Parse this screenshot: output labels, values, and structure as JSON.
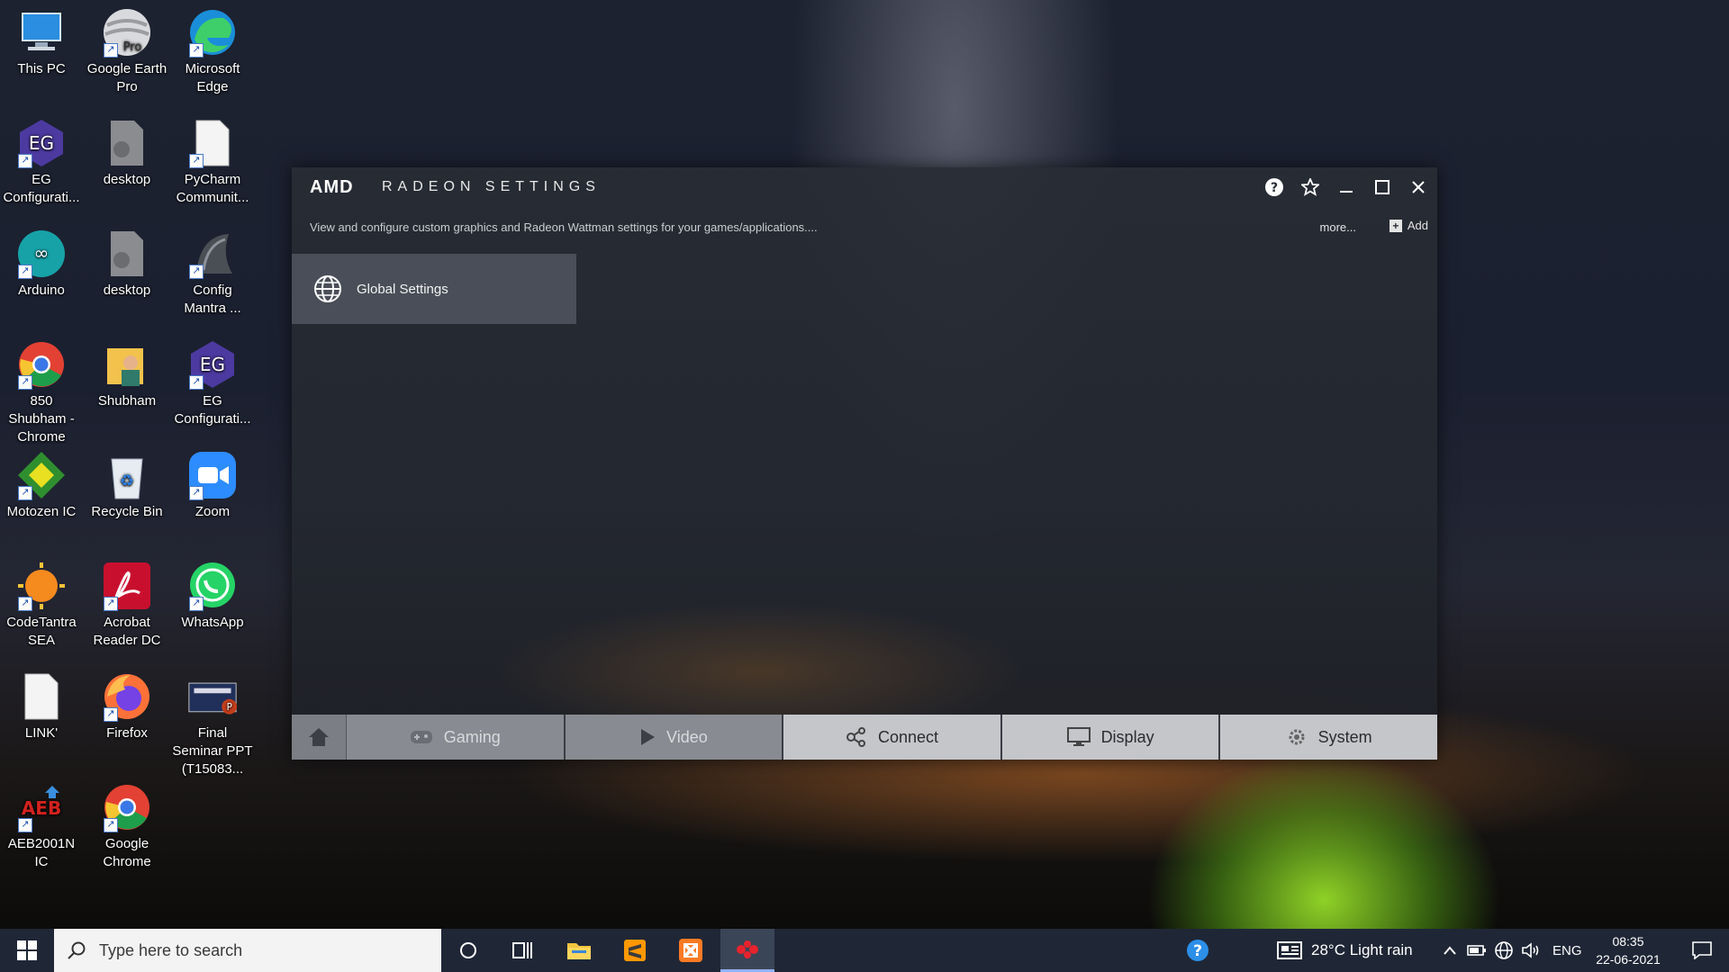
{
  "desktop": {
    "icons": [
      {
        "label": "This PC"
      },
      {
        "label": "Google Earth Pro",
        "badge": "Pro"
      },
      {
        "label": "Microsoft Edge"
      },
      {
        "label": "EG Configurati..."
      },
      {
        "label": "desktop"
      },
      {
        "label": "PyCharm Communit..."
      },
      {
        "label": "Arduino"
      },
      {
        "label": "desktop"
      },
      {
        "label": "Config Mantra ..."
      },
      {
        "label": "850 Shubham - Chrome"
      },
      {
        "label": "Shubham"
      },
      {
        "label": "EG Configurati..."
      },
      {
        "label": "Motozen IC"
      },
      {
        "label": "Recycle Bin"
      },
      {
        "label": "Zoom"
      },
      {
        "label": "CodeTantra SEA"
      },
      {
        "label": "Acrobat Reader DC"
      },
      {
        "label": "WhatsApp"
      },
      {
        "label": "LINK'"
      },
      {
        "label": "Firefox"
      },
      {
        "label": "Final Seminar PPT (T15083..."
      },
      {
        "label": "AEB2001N IC",
        "logo_text": "AEB"
      },
      {
        "label": "Google Chrome"
      }
    ]
  },
  "amd_window": {
    "logo": "AMD",
    "title": "RADEON SETTINGS",
    "subtitle": "View and configure custom graphics and Radeon Wattman settings for your games/applications....",
    "more_label": "more...",
    "add_label": "Add",
    "global_settings_label": "Global Settings",
    "nav": {
      "gaming": "Gaming",
      "video": "Video",
      "connect": "Connect",
      "display": "Display",
      "system": "System"
    }
  },
  "taskbar": {
    "search_placeholder": "Type here to search",
    "weather": "28°C  Light rain",
    "language": "ENG",
    "time": "08:35",
    "date": "22-06-2021"
  },
  "colors": {
    "taskbar_bg": "#1f2736",
    "window_bg": "#2a2e36",
    "nav_dark": "#888b91",
    "nav_light": "#c4c6ca"
  }
}
